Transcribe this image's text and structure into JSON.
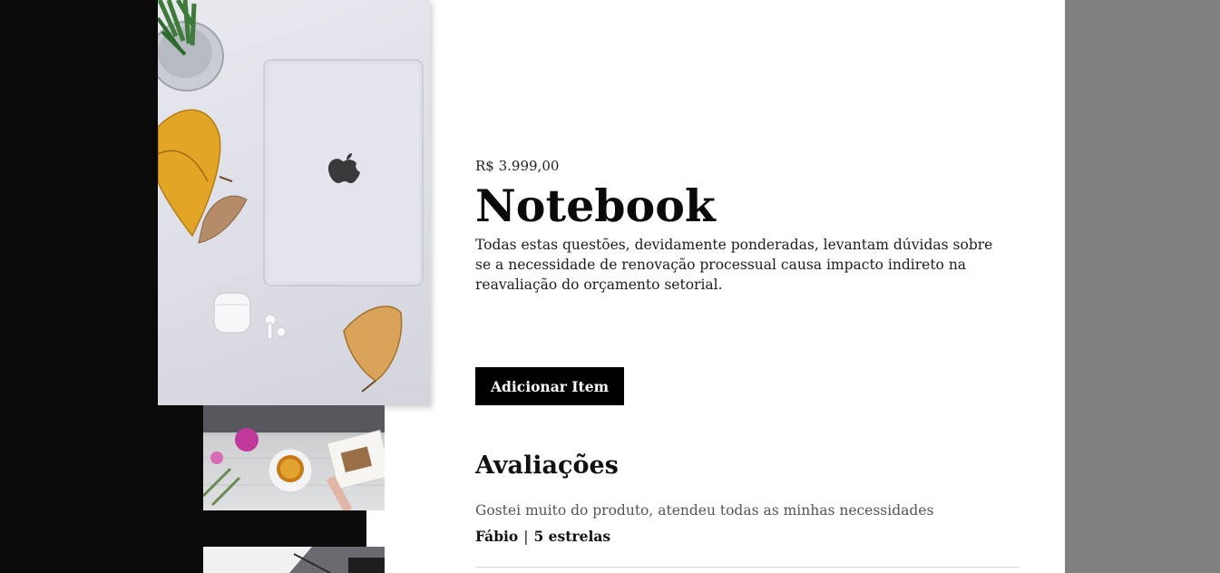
{
  "product": {
    "price": "R$ 3.999,00",
    "name": "Notebook",
    "description": "Todas estas questões, devidamente ponderadas, levantam dúvidas sobre se a necessidade de renovação processual causa impacto indireto na reavaliação do orçamento setorial.",
    "add_button_label": "Adicionar Item"
  },
  "gallery": {
    "main_image": "laptop-photo",
    "thumbnails": [
      "tea-flowers-photo",
      "desk-photo"
    ]
  },
  "reviews": {
    "title": "Avaliações",
    "items": [
      {
        "text": "Gostei muito do produto, atendeu todas as minhas necessidades",
        "author": "Fábio",
        "separator": "|",
        "rating": "5 estrelas"
      }
    ]
  },
  "colors": {
    "left_background": "#0b0b0b",
    "right_background": "#808080",
    "button": "#000000"
  }
}
